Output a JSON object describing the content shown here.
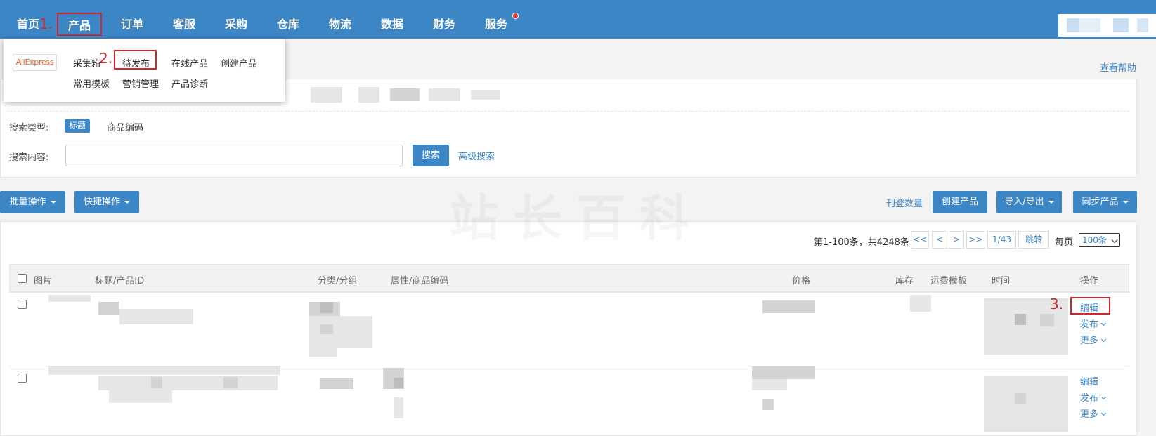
{
  "nav": {
    "items": [
      "首页",
      "产品",
      "订单",
      "客服",
      "采购",
      "仓库",
      "物流",
      "数据",
      "财务",
      "服务"
    ],
    "active": "产品"
  },
  "steps": {
    "one": "1.",
    "two": "2.",
    "three": "3."
  },
  "dropdown": {
    "platform_logo": "AliExpress",
    "items_row1": [
      "采集箱",
      "待发布",
      "在线产品",
      "创建产品"
    ],
    "items_row2": [
      "常用模板",
      "营销管理",
      "产品诊断"
    ],
    "highlighted": "待发布"
  },
  "help": {
    "label": "查看帮助"
  },
  "filter": {
    "search_type_label": "搜索类型:",
    "search_types": [
      "标题",
      "商品编码"
    ],
    "search_type_selected": "标题",
    "search_content_label": "搜索内容:",
    "search_value": "",
    "search_button": "搜索",
    "advanced_search": "高级搜索"
  },
  "toolbar": {
    "bulk_ops": "批量操作",
    "quick_ops": "快捷操作",
    "listing_count": "刊登数量",
    "create_product": "创建产品",
    "import_export": "导入/导出",
    "sync_products": "同步产品"
  },
  "pager": {
    "info": "第1-100条，共4248条",
    "first": "<<",
    "prev": "<",
    "next": ">",
    "last": ">>",
    "current": "1/43",
    "jump": "跳转",
    "per_page_label": "每页",
    "per_page_value": "100条"
  },
  "table": {
    "columns": [
      "图片",
      "标题/产品ID",
      "分类/分组",
      "属性/商品编码",
      "价格",
      "库存",
      "运费模板",
      "时间",
      "操作"
    ],
    "row_actions": [
      "编辑",
      "发布",
      "更多"
    ]
  },
  "colors": {
    "primary": "#3d86c6",
    "highlight": "#d0262e",
    "notification": "#e53935"
  }
}
